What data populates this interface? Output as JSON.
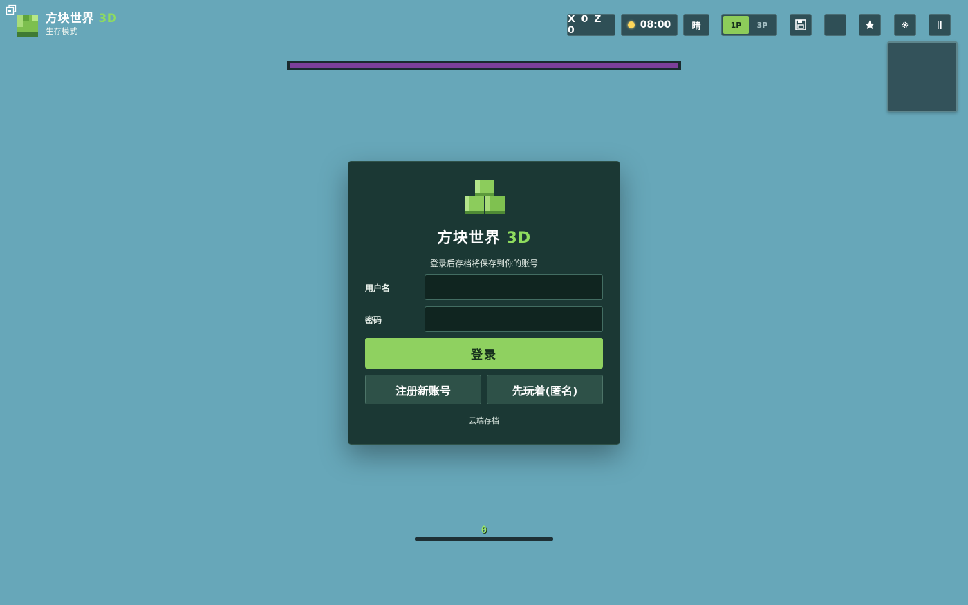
{
  "brand": {
    "title_main": "方块世界",
    "title_accent": "3D",
    "subtitle": "生存模式"
  },
  "hud": {
    "coords": "X 0 Z 0",
    "time": "08:00",
    "weather": "晴",
    "view_first": "1P",
    "view_third": "3P",
    "active_view": "1P",
    "icons": {
      "save": "save-icon",
      "star": "star-icon",
      "settings": "gear-icon",
      "pause": "pause-icon"
    }
  },
  "login": {
    "title_main": "方块世界",
    "title_accent": "3D",
    "hint": "登录后存档将保存到你的账号",
    "username_label": "用户名",
    "username_value": "",
    "password_label": "密码",
    "password_value": "",
    "login_label": "登录",
    "register_label": "注册新账号",
    "guest_label": "先玩着(匿名)",
    "cloud_label": "云端存档"
  },
  "status": {
    "xp_level": "0"
  },
  "colors": {
    "sky": "#67a7b9",
    "accent_green": "#8fdc5e",
    "card_bg": "#1b3834",
    "progress_purple": "#7c3f9a"
  }
}
